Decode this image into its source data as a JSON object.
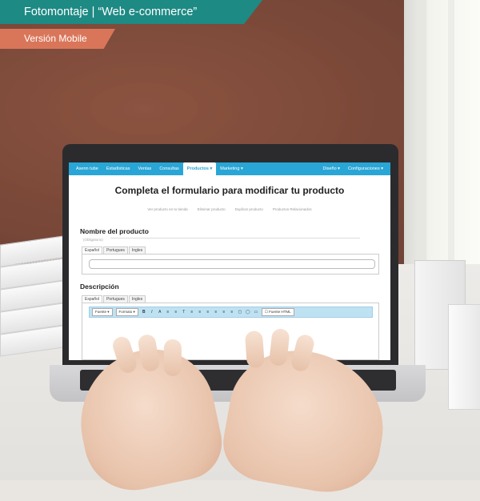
{
  "overlay": {
    "title": "Fotomontaje | “Web e-commerce”",
    "subtitle": "Versión Mobile",
    "colors": {
      "title_bg": "#1e8a84",
      "subtitle_bg": "#d9765a"
    }
  },
  "navbar": {
    "items": [
      "Asenn tube",
      "Estadísticas",
      "Ventas",
      "Consultas",
      "Productos ▾",
      "Marketing ▾"
    ],
    "right_items": [
      "Diseño ▾",
      "Configuraciones ▾"
    ],
    "active": "Productos ▾",
    "color": "#29a6d6"
  },
  "form": {
    "title": "Completa el formulario para modificar tu producto",
    "links": [
      "Ver producto en tu tienda",
      "Eliminar producto",
      "Duplicar producto",
      "Productos Relacionados"
    ]
  },
  "product_name": {
    "heading": "Nombre del producto",
    "hint": "(Obligatorio)",
    "tabs": [
      "Español",
      "Portugues",
      "Ingles"
    ]
  },
  "description": {
    "heading": "Descripción",
    "tabs": [
      "Español",
      "Portugues",
      "Ingles"
    ],
    "toolbar": {
      "font_select": "Fuente",
      "format_select": "Formato",
      "buttons": [
        "B",
        "I",
        "A",
        "≡",
        "≡",
        "T",
        "≡",
        "≡",
        "≡",
        "≡",
        "≡",
        "≡",
        "▢",
        "◯",
        "▭"
      ],
      "source_label": "Fuente HTML"
    }
  }
}
